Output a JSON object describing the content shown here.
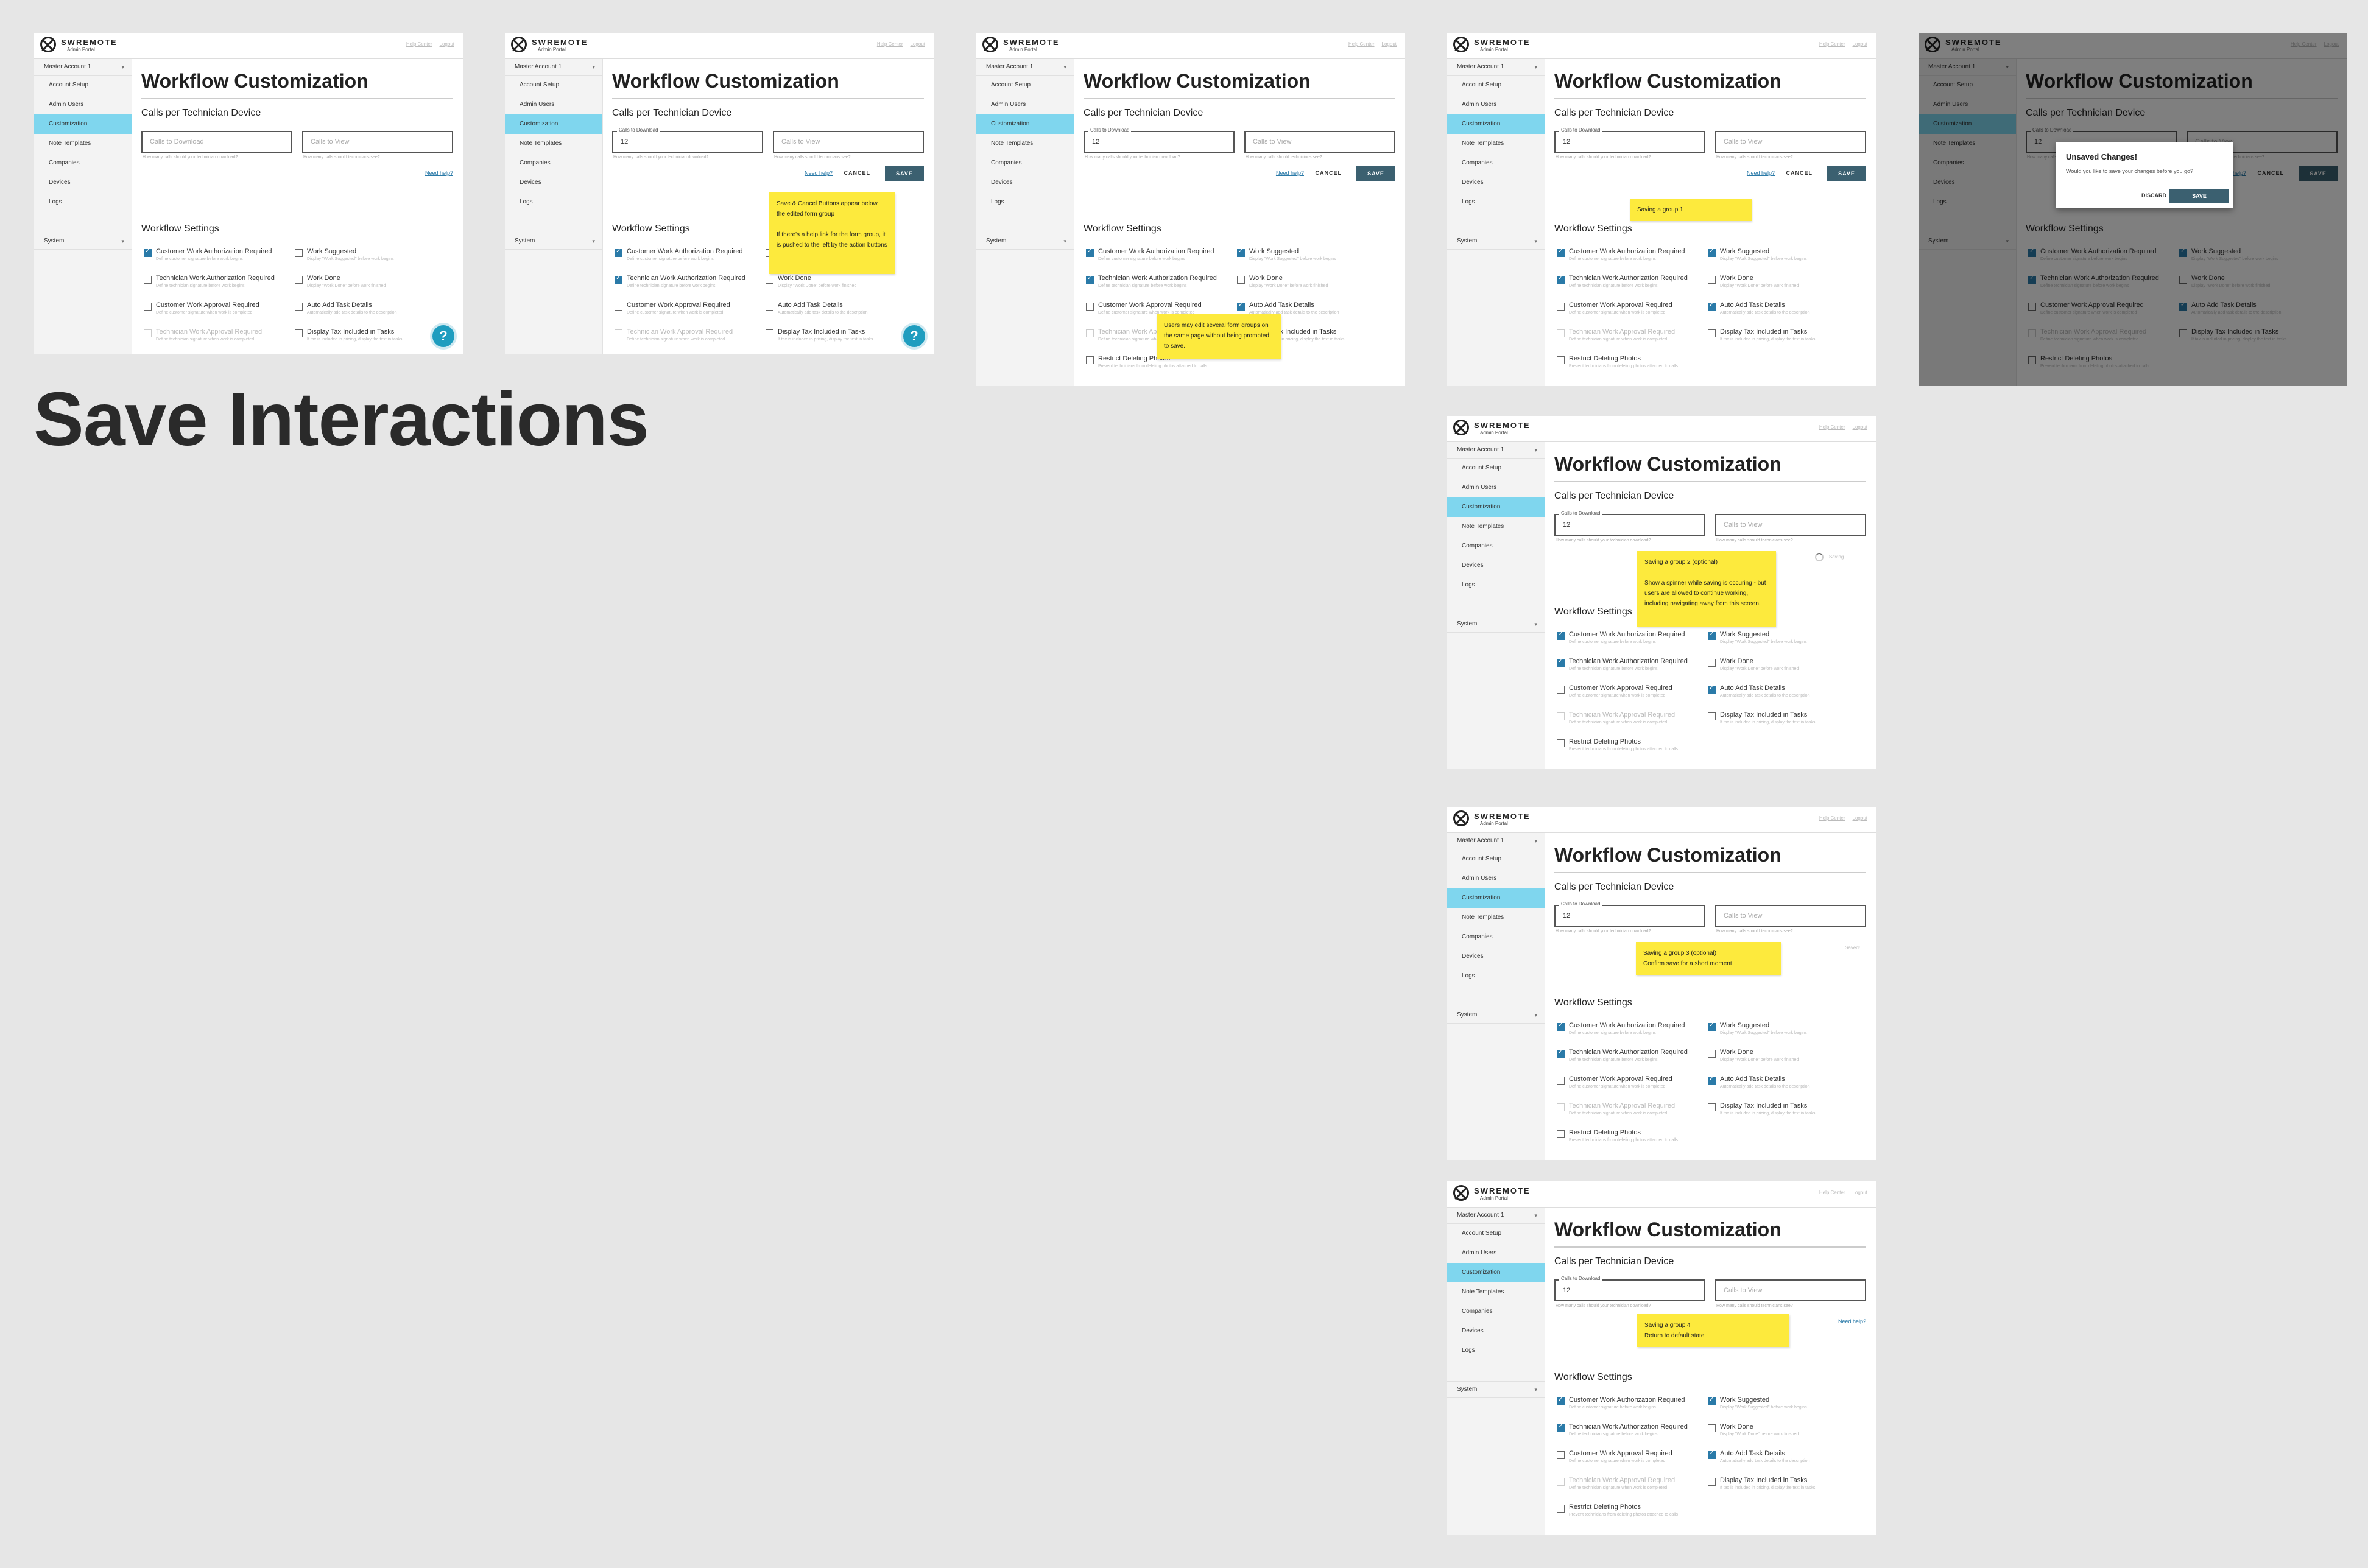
{
  "page_title": "Save Interactions",
  "app": {
    "brand": "SWREMOTE",
    "sub": "Admin Portal",
    "header_links": [
      "Help Center",
      "Logout"
    ]
  },
  "sidebar": {
    "account": "Master Account 1",
    "items": [
      "Account Setup",
      "Admin Users",
      "Customization",
      "Note Templates",
      "Companies",
      "Devices",
      "Logs"
    ],
    "active": "Customization",
    "system": "System"
  },
  "main": {
    "title": "Workflow Customization",
    "section_calls": "Calls per Technician Device",
    "download_label": "Calls to Download",
    "download_value": "12",
    "download_placeholder": "Calls to Download",
    "download_hint": "How many calls should your technician download?",
    "view_placeholder": "Calls to View",
    "view_hint": "How many calls should technicians see?",
    "need_help": "Need help?",
    "cancel": "CANCEL",
    "save": "SAVE",
    "section_workflow": "Workflow Settings",
    "settings_left": [
      {
        "label": "Customer Work Authorization Required",
        "sub": "Define customer signature before work begins"
      },
      {
        "label": "Technician Work Authorization Required",
        "sub": "Define technician signature before work begins"
      },
      {
        "label": "Customer Work Approval Required",
        "sub": "Define customer signature when work is completed"
      },
      {
        "label": "Technician Work Approval Required",
        "sub": "Define technician signature when work is completed"
      },
      {
        "label": "Restrict Deleting Photos",
        "sub": "Prevent technicians from deleting photos attached to calls"
      }
    ],
    "settings_right": [
      {
        "label": "Work Suggested",
        "sub": "Display \"Work Suggested\" before work begins"
      },
      {
        "label": "Work Done",
        "sub": "Display \"Work Done\" before work finished"
      },
      {
        "label": "Auto Add Task Details",
        "sub": "Automatically add task details to the description"
      },
      {
        "label": "Display Tax Included in Tasks",
        "sub": "If tax is included in pricing, display the text in tasks"
      }
    ]
  },
  "notes": {
    "n2": "Save & Cancel Buttons appear below the edited form group\n\nIf there's a help link for the form group, it is pushed to the left by the action buttons",
    "n3": "Users may edit several form groups on the same page without being prompted to save.",
    "n4": "Saving a group 1",
    "n6": "Saving a group 2 (optional)\n\nShow a spinner while saving is occuring - but users are allowed to continue working, including navigating away from this screen.",
    "n7": "Saving a group 3 (optional)\nConfirm save for a short moment",
    "n8": "Saving a group 4\nReturn to default state"
  },
  "modal": {
    "title": "Unsaved Changes!",
    "message": "Would you like to save your changes before you go?",
    "discard": "DISCARD",
    "save": "SAVE"
  },
  "status": {
    "saving": "Saving...",
    "saved": "Saved!"
  },
  "colors": {
    "accent": "#7fd6ee",
    "save_button": "#3b6070",
    "note": "#fdea3d",
    "check": "#2a7aa8"
  }
}
